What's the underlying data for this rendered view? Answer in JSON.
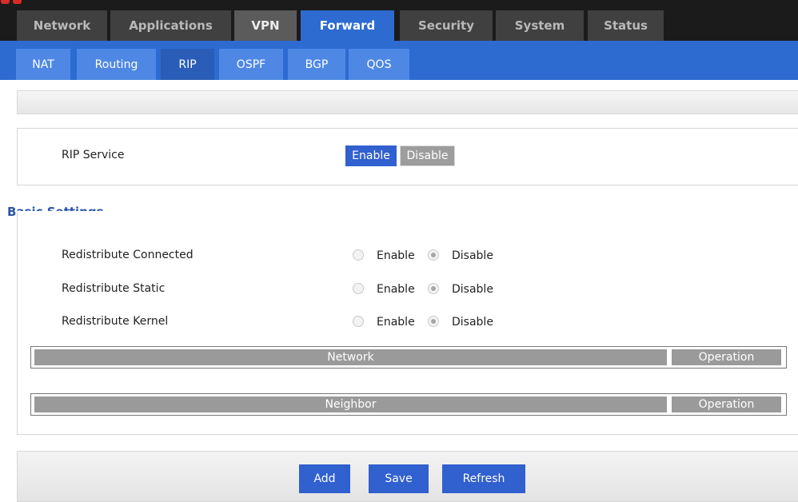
{
  "main_tabs": [
    {
      "label": "Network"
    },
    {
      "label": "Applications"
    },
    {
      "label": "VPN"
    },
    {
      "label": "Forward"
    },
    {
      "label": "Security"
    },
    {
      "label": "System"
    },
    {
      "label": "Status"
    }
  ],
  "active_main_tab": "Forward",
  "sub_tabs": [
    {
      "label": "NAT"
    },
    {
      "label": "Routing"
    },
    {
      "label": "RIP"
    },
    {
      "label": "OSPF"
    },
    {
      "label": "BGP"
    },
    {
      "label": "QOS"
    }
  ],
  "active_sub_tab": "RIP",
  "service": {
    "label": "RIP Service",
    "enable_label": "Enable",
    "disable_label": "Disable",
    "selected": "Enable"
  },
  "basic_settings": {
    "title": "Basic Settings",
    "rows": [
      {
        "label": "Redistribute Connected",
        "enable_label": "Enable",
        "disable_label": "Disable",
        "value": "Disable"
      },
      {
        "label": "Redistribute Static",
        "enable_label": "Enable",
        "disable_label": "Disable",
        "value": "Disable"
      },
      {
        "label": "Redistribute Kernel",
        "enable_label": "Enable",
        "disable_label": "Disable",
        "value": "Disable"
      }
    ]
  },
  "network_table": {
    "columns": [
      "Network",
      "Operation"
    ]
  },
  "neighbor_table": {
    "columns": [
      "Neighbor",
      "Operation"
    ]
  },
  "footer": {
    "add_label": "Add",
    "save_label": "Save",
    "refresh_label": "Refresh"
  },
  "colors": {
    "accent": "#2d6bd1",
    "title_blue": "#2c55a8",
    "header_gray": "#9a9a9a"
  }
}
